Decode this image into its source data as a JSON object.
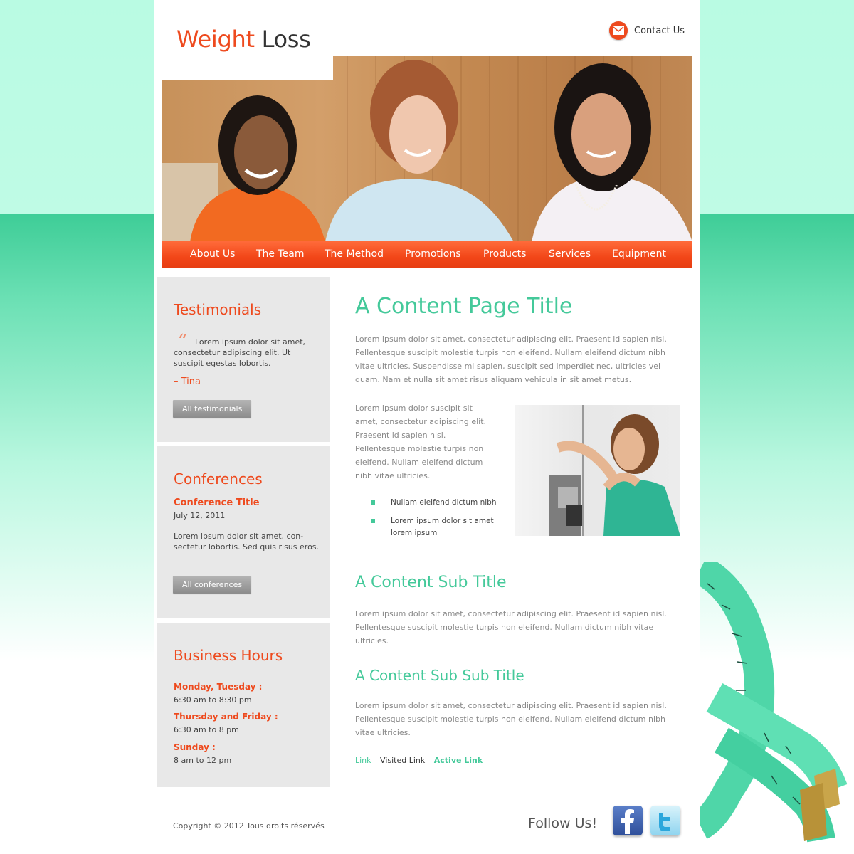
{
  "brand": {
    "word1": "Weight",
    "word2": "Loss"
  },
  "header": {
    "contact_label": "Contact Us"
  },
  "nav": {
    "items": [
      "About Us",
      "The Team",
      "The Method",
      "Promotions",
      "Products",
      "Services",
      "Equipment"
    ]
  },
  "testimonials": {
    "title": "Testimonials",
    "quote_mark": "“",
    "quote": "Lorem ipsum dolor sit amet, consectetur adipiscing elit. Ut suscipit egestas lobortis.",
    "author": "– Tina",
    "button": "All testimonials"
  },
  "conferences": {
    "title": "Conferences",
    "item_title": "Conference Title",
    "date": "July 12, 2011",
    "text": "Lorem ipsum dolor sit amet, con-sectetur lobortis. Sed quis risus eros.",
    "button": "All conferences"
  },
  "hours": {
    "title": "Business Hours",
    "rows": [
      {
        "days": "Monday, Tuesday :",
        "time": "6:30 am to 8:30 pm"
      },
      {
        "days": "Thursday and Friday :",
        "time": "6:30 am to 8 pm"
      },
      {
        "days": "Sunday :",
        "time": "8 am to 12 pm"
      }
    ]
  },
  "main": {
    "title": "A Content Page Title",
    "intro": "Lorem ipsum dolor sit amet, consectetur adipiscing elit. Praesent id sapien nisl. Pellentesque suscipit molestie turpis non eleifend. Nullam eleifend dictum nibh vitae ultricies. Suspendisse mi sapien, suscipit sed imperdiet nec, ultricies vel quam. Nam et nulla sit amet risus aliquam vehicula in sit amet metus.",
    "side_text": "Lorem ipsum dolor suscipit sit amet, consectetur adipiscing elit. Praesent id sapien nisl. Pellentesque molestie turpis non eleifend. Nullam eleifend dictum nibh vitae ultricies.",
    "list": [
      "Nullam eleifend dictum nibh",
      "Lorem ipsum dolor sit amet lorem ipsum"
    ],
    "sub_title": "A Content Sub Title",
    "sub_text": "Lorem ipsum dolor sit amet, consectetur adipiscing elit. Praesent id sapien nisl. Pellentesque suscipit molestie turpis non eleifend. Nullam dictum nibh vitae ultricies.",
    "subsub_title": "A Content Sub Sub Title",
    "subsub_text": "Lorem ipsum dolor sit amet, consectetur adipiscing elit. Praesent id sapien nisl. Pellentesque suscipit molestie turpis non eleifend. Nullam eleifend dictum nibh vitae ultricies.",
    "links": {
      "link": "Link",
      "visited": "Visited Link",
      "active": "Active Link"
    }
  },
  "footer": {
    "copyright": "Copyright © 2012 Tous droits réservés",
    "follow": "Follow Us!",
    "social_icons": [
      "facebook-icon",
      "twitter-icon"
    ]
  },
  "colors": {
    "brand_orange": "#ee4a1e",
    "accent_green": "#44c99a",
    "background_mint": "#b9fbe3"
  }
}
